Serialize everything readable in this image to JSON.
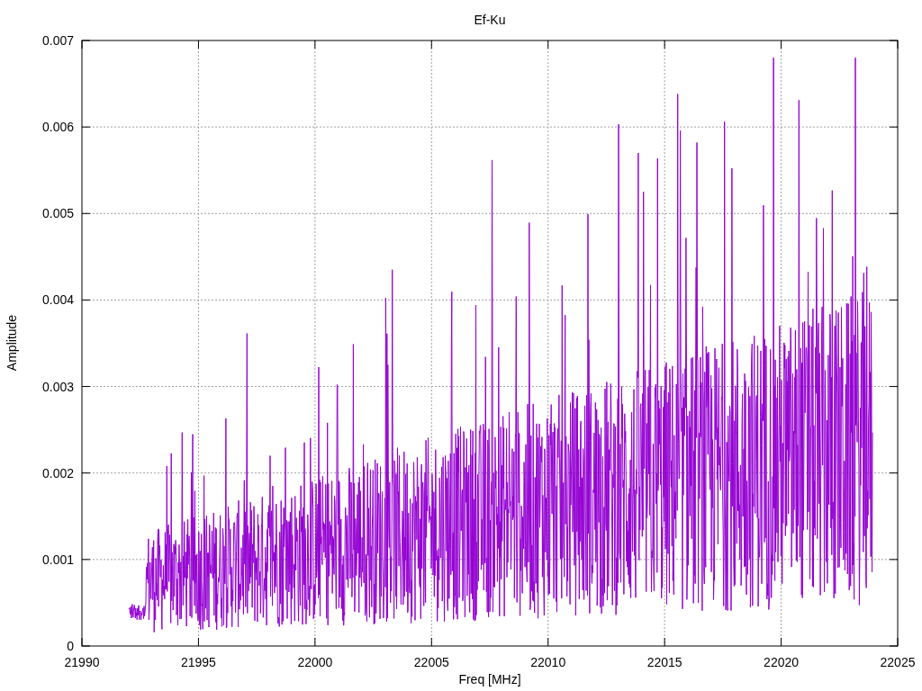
{
  "plot": {
    "title": "Ef-Ku",
    "xlabel": "Freq [MHz]",
    "ylabel": "Amplitude",
    "x_ticks": [
      "21990",
      "21995",
      "22000",
      "22005",
      "22010",
      "22015",
      "22020",
      "22025"
    ],
    "y_ticks": [
      "0.007",
      "0.006",
      "0.005",
      "0.004",
      "0.003",
      "0.002",
      "0.001",
      "0"
    ]
  }
}
